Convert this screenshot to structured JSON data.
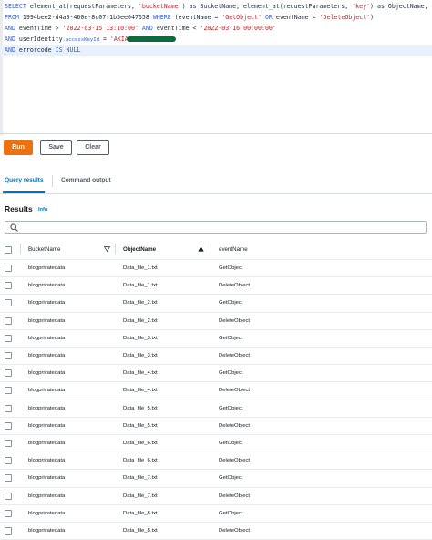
{
  "editor": {
    "line1": {
      "kw_select": "SELECT",
      "fn1": "element_at(requestParameters,",
      "str1": "'bucketName'",
      "txt1": ") as BucketName, element_at(requestParameters,",
      "str2": "'key'",
      "txt2": ") as ObjectName, eventName"
    },
    "line2": {
      "kw_from": "FROM",
      "table": "1994bee2-d4a0-460e-8c07-1b5ee047658",
      "kw_where": "WHERE",
      "txt1": "(eventName =",
      "str1": "'GetObject'",
      "kw_or": "OR",
      "txt2": "eventName =",
      "str2": "'DeleteObject'",
      "txt3": ")"
    },
    "line3": {
      "kw_and": "AND",
      "txt1": "eventTime >",
      "str1": "'2022-03-15 13:10:00'",
      "kw_and2": "AND",
      "txt2": "eventTime <",
      "str2": "'2022-03-16 00:00:00'"
    },
    "line4": {
      "kw_and": "AND",
      "txt1": "userIdentity",
      "path": ".accessKeyId",
      "txt2": "=",
      "str1": "'AKIA"
    },
    "line5": {
      "kw_and": "AND",
      "txt1": "errorcode",
      "kw_is": "IS NULL"
    }
  },
  "buttons": {
    "run": "Run",
    "save": "Save",
    "clear": "Clear"
  },
  "tabs": [
    "Query results",
    "Command output"
  ],
  "results": {
    "title": "Results",
    "info": "Info",
    "search_placeholder": ""
  },
  "table": {
    "columns": [
      "BucketName",
      "ObjectName",
      "eventName"
    ],
    "rows": [
      [
        "blogprivatedata",
        "Data_file_1.txt",
        "GetObject"
      ],
      [
        "blogprivatedata",
        "Data_file_1.txt",
        "DeleteObject"
      ],
      [
        "blogprivatedata",
        "Data_file_2.txt",
        "GetObject"
      ],
      [
        "blogprivatedata",
        "Data_file_2.txt",
        "DeleteObject"
      ],
      [
        "blogprivatedata",
        "Data_file_3.txt",
        "GetObject"
      ],
      [
        "blogprivatedata",
        "Data_file_3.txt",
        "DeleteObject"
      ],
      [
        "blogprivatedata",
        "Data_file_4.txt",
        "GetObject"
      ],
      [
        "blogprivatedata",
        "Data_file_4.txt",
        "DeleteObject"
      ],
      [
        "blogprivatedata",
        "Data_file_5.txt",
        "GetObject"
      ],
      [
        "blogprivatedata",
        "Data_file_5.txt",
        "DeleteObject"
      ],
      [
        "blogprivatedata",
        "Data_file_6.txt",
        "GetObject"
      ],
      [
        "blogprivatedata",
        "Data_file_6.txt",
        "DeleteObject"
      ],
      [
        "blogprivatedata",
        "Data_file_7.txt",
        "GetObject"
      ],
      [
        "blogprivatedata",
        "Data_file_7.txt",
        "DeleteObject"
      ],
      [
        "blogprivatedata",
        "Data_file_8.txt",
        "GetObject"
      ],
      [
        "blogprivatedata",
        "Data_file_8.txt",
        "DeleteObject"
      ]
    ]
  },
  "icons": {
    "search": "search-icon",
    "sort_down": "caret-down-icon",
    "sort_up": "caret-up-icon"
  },
  "colors": {
    "run_button": "#ec7211",
    "link": "#0073bb",
    "keyword": "#3b61c9",
    "string": "#b3262b"
  }
}
